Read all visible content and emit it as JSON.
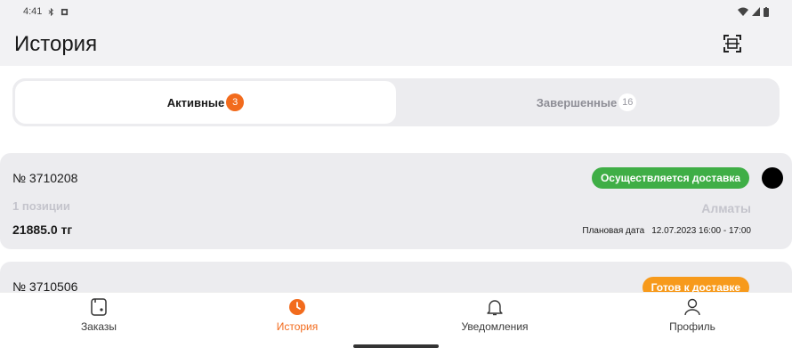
{
  "status_bar": {
    "time": "4:41"
  },
  "header": {
    "title": "История"
  },
  "tabs": [
    {
      "label": "Активные",
      "count": "3",
      "active": true
    },
    {
      "label": "Завершенные",
      "count": "16",
      "active": false
    }
  ],
  "orders": [
    {
      "number": "№ 3710208",
      "status": "Осуществляется доставка",
      "status_color": "#3fae46",
      "positions": "1 позиции",
      "city": "Алматы",
      "price": "21885.0 тг",
      "planned_label": "Плановая дата",
      "planned_value": "12.07.2023 16:00 - 17:00"
    },
    {
      "number": "№ 3710506",
      "status": "Готов к доставке",
      "status_color": "#f79a1b"
    }
  ],
  "bottom_nav": [
    {
      "label": "Заказы",
      "icon": "orders-icon",
      "active": false
    },
    {
      "label": "История",
      "icon": "history-clock-icon",
      "active": true
    },
    {
      "label": "Уведомления",
      "icon": "bell-icon",
      "active": false
    },
    {
      "label": "Профиль",
      "icon": "profile-icon",
      "active": false
    }
  ],
  "colors": {
    "accent": "#f26b1d",
    "background": "#f2f2f4",
    "card": "#ececef"
  }
}
